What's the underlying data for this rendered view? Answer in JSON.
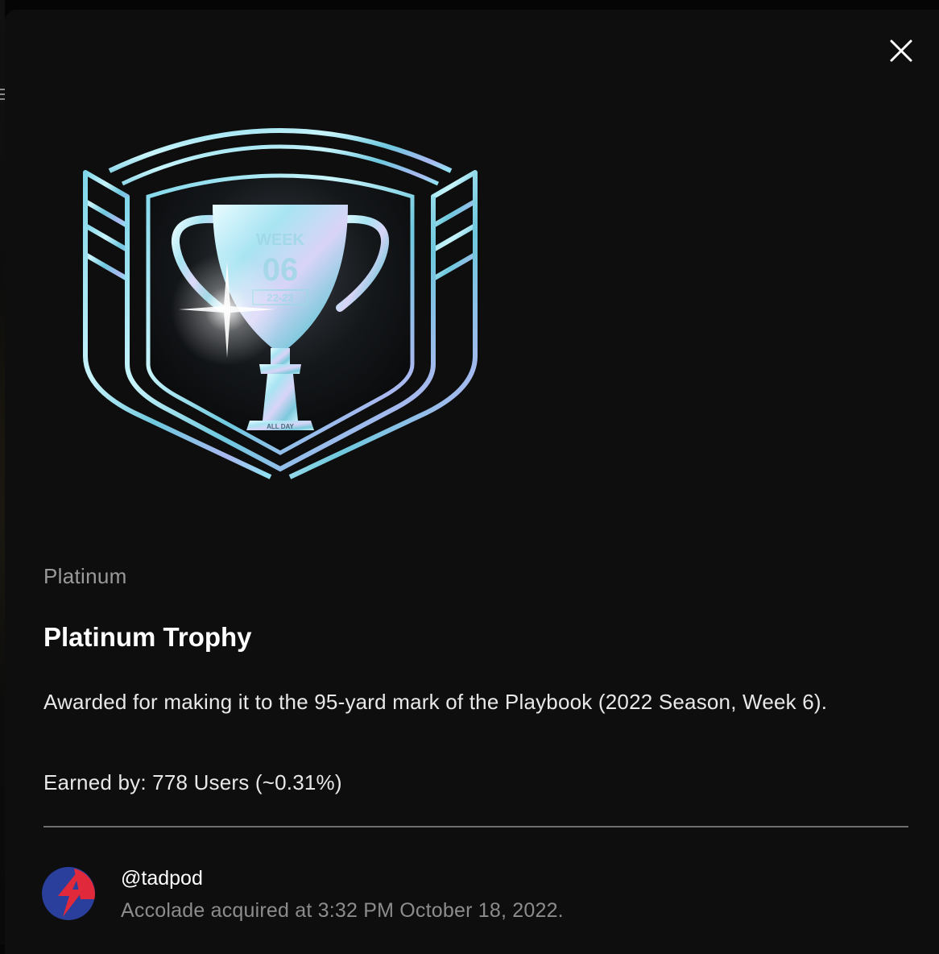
{
  "modal": {
    "close_icon": "close-icon",
    "badge": {
      "icon": "trophy-shield-icon",
      "week_label": "WEEK",
      "week_number": "06",
      "season": "22-23",
      "base_text": "ALL DAY"
    },
    "tier": "Platinum",
    "title": "Platinum Trophy",
    "description": "Awarded for making it to the 95-yard mark of the Playbook (2022 Season, Week 6).",
    "earned_by": "Earned by: 778 Users (~0.31%)"
  },
  "owner": {
    "avatar_icon": "lightning-bolt-icon",
    "username": "@tadpod",
    "acquired_text": "Accolade acquired at 3:32 PM October 18, 2022."
  },
  "colors": {
    "background": "#0e0e0e",
    "badge_cyan": "#8fe3f2",
    "avatar_blue": "#2a3f9c",
    "avatar_red": "#e0293a",
    "muted_text": "#8c8c8c"
  }
}
